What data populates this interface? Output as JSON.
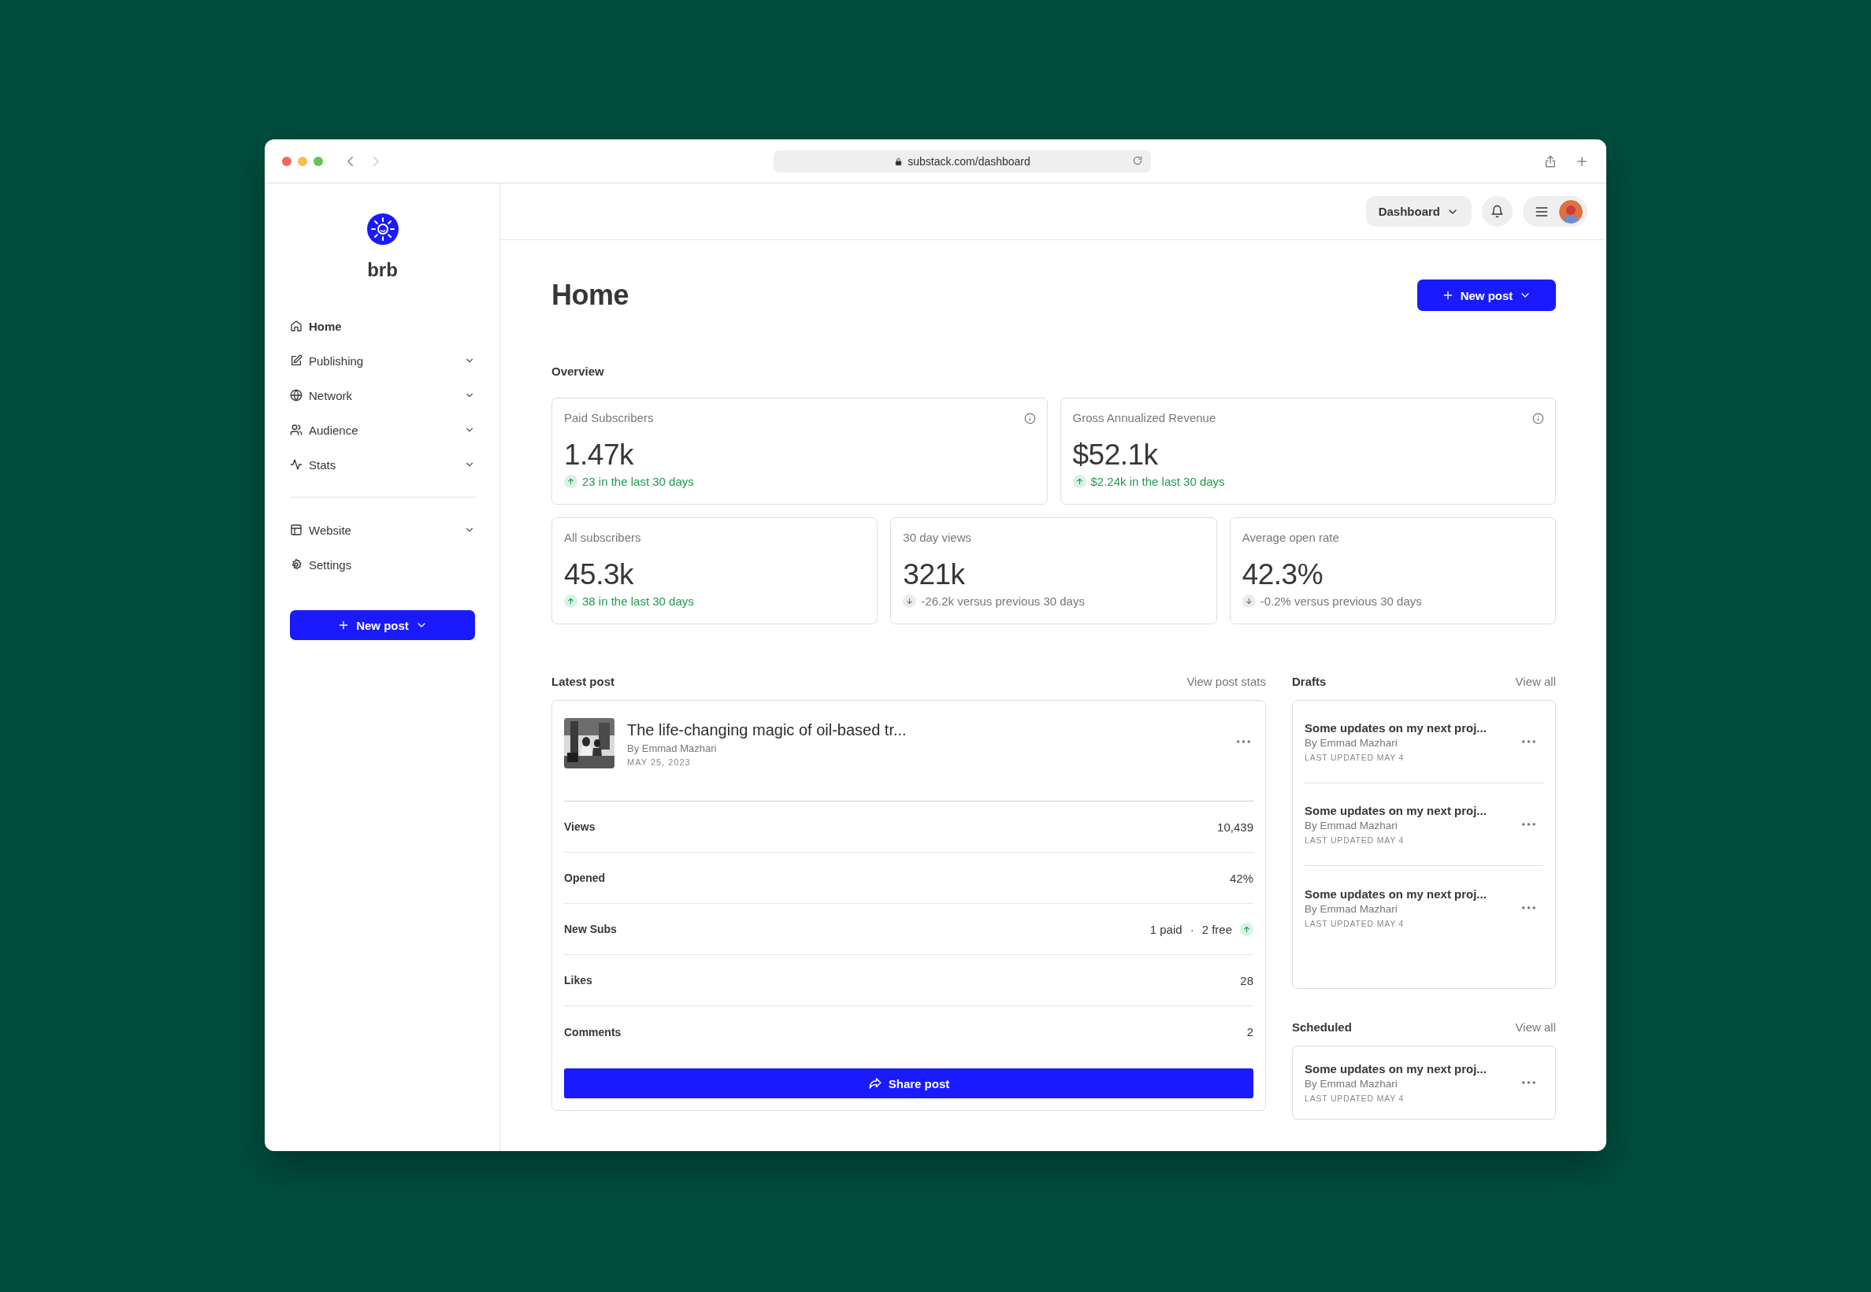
{
  "browser": {
    "url": "substack.com/dashboard"
  },
  "sidebar": {
    "publication": "brb",
    "groups": [
      {
        "items": [
          {
            "label": "Home",
            "kind": "home",
            "selected": true,
            "expandable": false
          },
          {
            "label": "Publishing",
            "kind": "edit",
            "selected": false,
            "expandable": true
          },
          {
            "label": "Network",
            "kind": "globe",
            "selected": false,
            "expandable": true
          },
          {
            "label": "Audience",
            "kind": "users",
            "selected": false,
            "expandable": true
          },
          {
            "label": "Stats",
            "kind": "activity",
            "selected": false,
            "expandable": true
          }
        ]
      },
      {
        "items": [
          {
            "label": "Website",
            "kind": "layout",
            "selected": false,
            "expandable": true
          },
          {
            "label": "Settings",
            "kind": "gear",
            "selected": false,
            "expandable": false
          }
        ]
      }
    ],
    "new_post": "New post"
  },
  "header": {
    "menu": "Dashboard"
  },
  "page": {
    "title": "Home",
    "new_post": "New post"
  },
  "overview": {
    "title": "Overview",
    "cards": [
      {
        "label": "Paid Subscribers",
        "value": "1.47k",
        "change": "23 in the last 30 days",
        "rising": true,
        "info": true
      },
      {
        "label": "Gross Annualized Revenue",
        "value": "$52.1k",
        "change": "$2.24k in the last 30 days",
        "rising": true,
        "info": true
      },
      {
        "label": "All subscribers",
        "value": "45.3k",
        "change": "38 in the last 30 days",
        "rising": true,
        "info": false
      },
      {
        "label": "30 day views",
        "value": "321k",
        "change": "-26.2k versus previous 30 days",
        "rising": false,
        "info": false
      },
      {
        "label": "Average open rate",
        "value": "42.3%",
        "change": "-0.2% versus previous 30 days",
        "rising": false,
        "info": false
      }
    ]
  },
  "latest_post": {
    "title": "Latest post",
    "link": "View post stats",
    "post": {
      "kind": "picture",
      "title": "The life-changing magic of oil-based tr...",
      "author": "By Emmad Mazhari",
      "date": "MAY 25, 2023"
    },
    "stats": [
      {
        "label": "Views",
        "values": [
          "10,439"
        ]
      },
      {
        "label": "Opened",
        "values": [
          "42%"
        ]
      },
      {
        "label": "New Subs",
        "values": [
          "1 paid",
          "·",
          "2 free"
        ],
        "rising": true
      },
      {
        "label": "Likes",
        "values": [
          "28"
        ]
      },
      {
        "label": "Comments",
        "values": [
          "2"
        ]
      }
    ],
    "share": "Share post"
  },
  "drafts": {
    "title": "Drafts",
    "link": "View all",
    "items": [
      {
        "title": "Some updates on my next proj...",
        "author": "By Emmad Mazhari",
        "updated": "LAST UPDATED MAY 4"
      },
      {
        "title": "Some updates on my next proj...",
        "author": "By Emmad Mazhari",
        "updated": "LAST UPDATED MAY 4"
      },
      {
        "title": "Some updates on my next proj...",
        "author": "By Emmad Mazhari",
        "updated": "LAST UPDATED MAY 4"
      }
    ]
  },
  "scheduled": {
    "title": "Scheduled",
    "link": "View all",
    "items": [
      {
        "title": "Some updates on my next proj...",
        "author": "By Emmad Mazhari",
        "updated": "LAST UPDATED MAY 4"
      }
    ]
  }
}
